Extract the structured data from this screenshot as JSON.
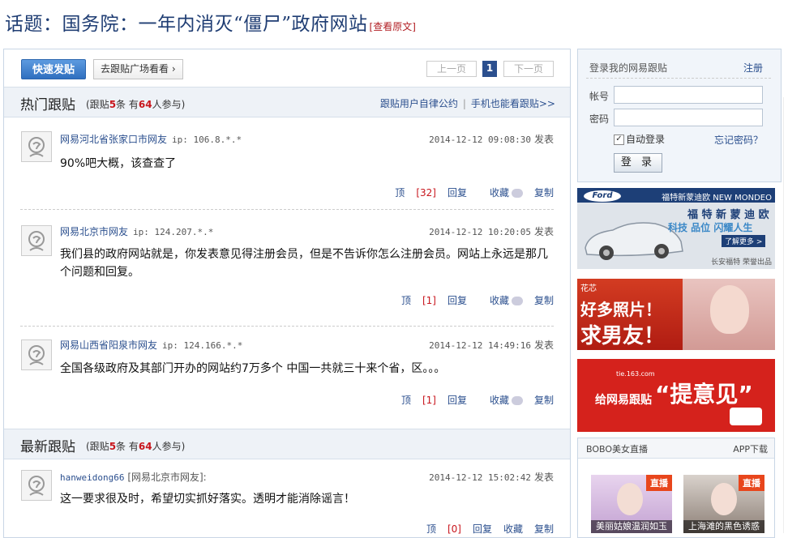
{
  "page": {
    "title": "话题：国务院：一年内消灭“僵尸”政府网站",
    "view_original": "[查看原文]"
  },
  "toolbar": {
    "post_button": "快速发贴",
    "plaza_button": "去跟贴广场看看 ›",
    "prev": "上一页",
    "current_page": "1",
    "next": "下一页"
  },
  "hot": {
    "title": "热门跟贴",
    "stat_prefix": "(跟贴",
    "posts_count": "5",
    "stat_mid": "条 有",
    "people_count": "64",
    "stat_suffix": "人参与)",
    "link_rules": "跟贴用户自律公约",
    "link_mobile": "手机也能看跟贴>>"
  },
  "latest": {
    "title": "最新跟贴",
    "stat_prefix": "(跟贴",
    "posts_count": "5",
    "stat_mid": "条 有",
    "people_count": "64",
    "stat_suffix": "人参与)"
  },
  "actions": {
    "up": "顶",
    "reply": "回复",
    "collect": "收藏",
    "copy": "复制",
    "posted": "发表"
  },
  "posts": [
    {
      "user": "网易河北省张家口市网友",
      "ip": "ip: 106.8.*.*",
      "time": "2014-12-12 09:08:30",
      "content": "90%吧大概，该查查了",
      "votes": "[32]"
    },
    {
      "user": "网易北京市网友",
      "ip": "ip: 124.207.*.*",
      "time": "2014-12-12 10:20:05",
      "content": "我们县的政府网站就是，你发表意见得注册会员，但是不告诉你怎么注册会员。网站上永远是那几个问题和回复。",
      "votes": "[1]"
    },
    {
      "user": "网易山西省阳泉市网友",
      "ip": "ip: 124.166.*.*",
      "time": "2014-12-12 14:49:16",
      "content": "全国各级政府及其部门开办的网站约7万多个 中国一共就三十来个省，区。。。",
      "votes": "[1]"
    }
  ],
  "latest_posts": [
    {
      "user": "hanweidong66",
      "location": "[网易北京市网友]:",
      "time": "2014-12-12 15:02:42",
      "content": "这一要求很及时，希望切实抓好落实。透明才能消除谣言！",
      "votes": "[0]"
    }
  ],
  "login": {
    "title": "登录我的网易跟贴",
    "register": "注册",
    "account_label": "帐号",
    "password_label": "密码",
    "auto_login": "自动登录",
    "auto_login_checked": true,
    "forgot": "忘记密码？",
    "submit": "登 录"
  },
  "ads": {
    "ford_tag": "福特新蒙迪欧 NEW MONDEO",
    "ford_brand": "Ford",
    "ford_headline": "福 特 新 蒙 迪 欧",
    "ford_sub": "科技 品位 闪耀人生",
    "ford_more": "了解更多 >",
    "ford_footer": "长安福特 荣誉出品",
    "photo_brand": "花芯",
    "photo_text1": "好多照片！",
    "photo_text2": "求男友！",
    "feedback_site": "tie.163.com",
    "feedback_text": "给网易跟贴",
    "feedback_big": "“提意见”"
  },
  "bobo": {
    "title": "BOBO美女直播",
    "app": "APP下载",
    "live_tag": "直播",
    "cards": [
      "美丽姑娘温润如玉",
      "上海滩的黑色诱惑"
    ]
  },
  "colors": {
    "brand_blue": "#2b4f8e",
    "accent_red": "#c8161d",
    "title_blue": "#1f3d73"
  }
}
